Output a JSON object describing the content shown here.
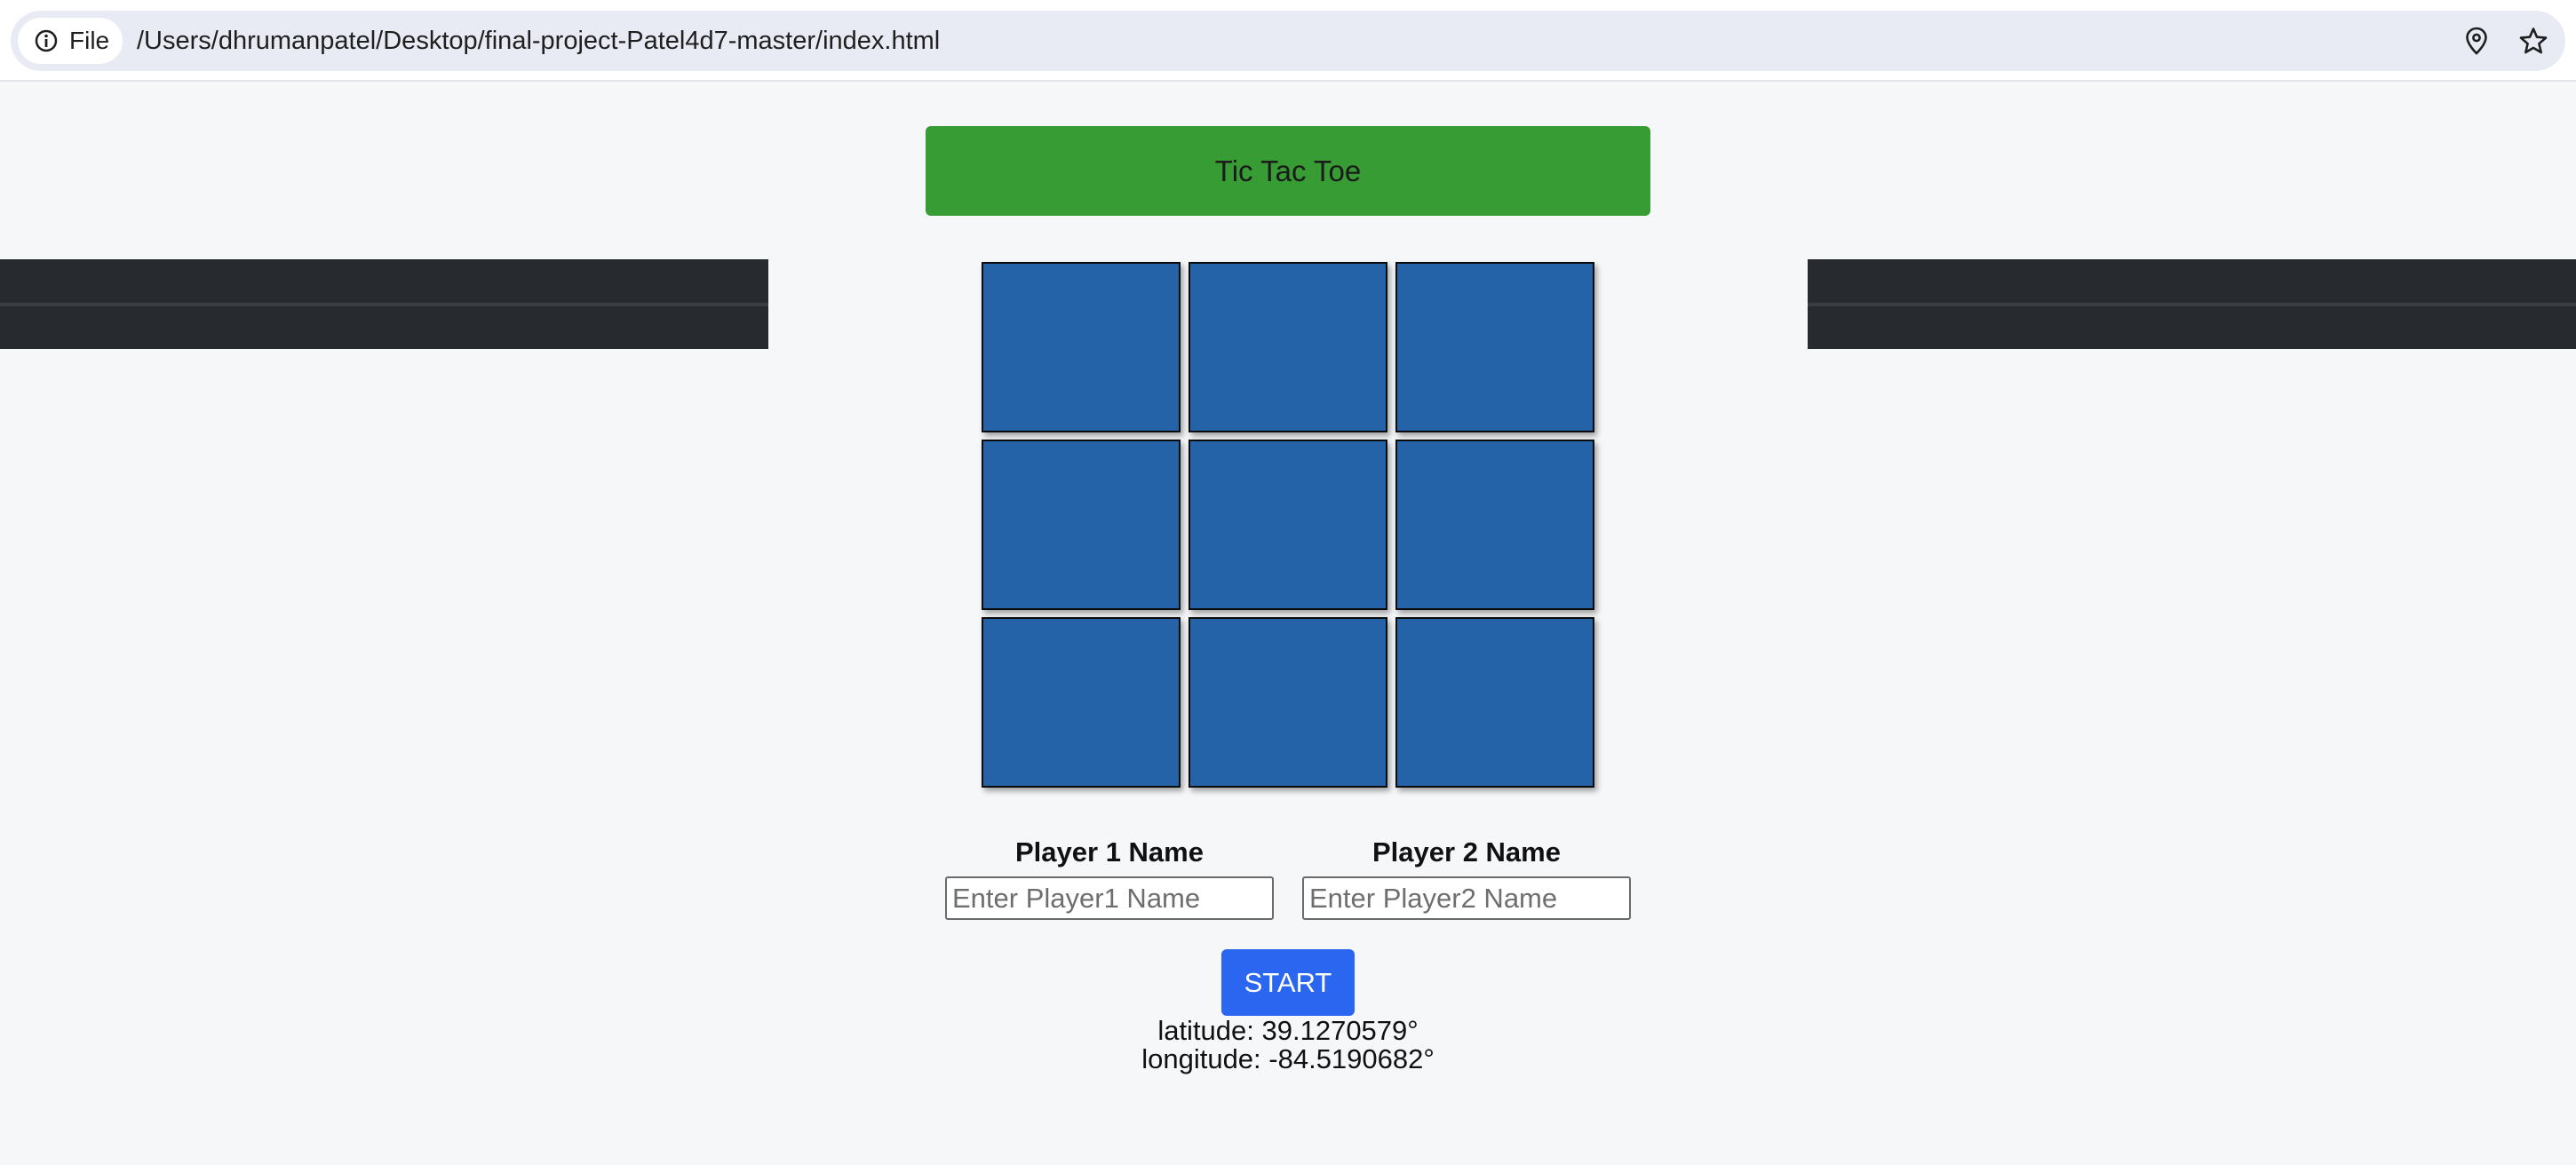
{
  "browser": {
    "site_chip_label": "File",
    "url": "/Users/dhrumanpatel/Desktop/final-project-Patel4d7-master/index.html",
    "icons": [
      "info-icon",
      "location-icon",
      "star-icon"
    ]
  },
  "game": {
    "title": "Tic Tac Toe",
    "cell_color": "#2563a8",
    "title_color": "#379c33",
    "cells": [
      "",
      "",
      "",
      "",
      "",
      "",
      "",
      "",
      ""
    ]
  },
  "players": {
    "p1_label": "Player 1 Name",
    "p1_placeholder": "Enter Player1 Name",
    "p1_value": "",
    "p2_label": "Player 2 Name",
    "p2_placeholder": "Enter Player2 Name",
    "p2_value": ""
  },
  "start_label": "START",
  "location": {
    "latitude": "latitude: 39.1270579°",
    "longitude": "longitude: -84.5190682°"
  }
}
